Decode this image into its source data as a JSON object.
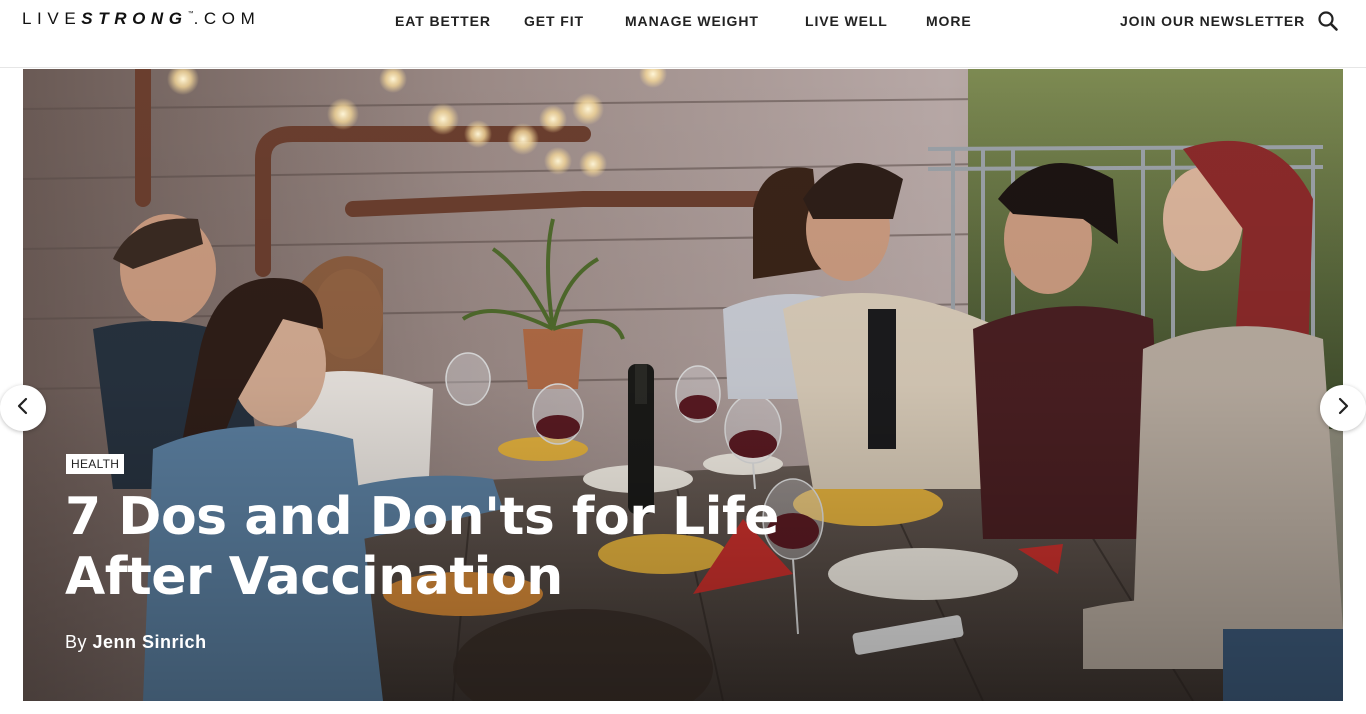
{
  "header": {
    "logo": {
      "pre": "LIVE",
      "bold": "STRONG",
      "tm": "™",
      "post": ".COM"
    },
    "nav": [
      {
        "label": "EAT BETTER"
      },
      {
        "label": "GET FIT"
      },
      {
        "label": "MANAGE WEIGHT"
      },
      {
        "label": "LIVE WELL"
      },
      {
        "label": "MORE"
      }
    ],
    "newsletter": "JOIN OUR NEWSLETTER",
    "search_icon": "search-icon"
  },
  "hero": {
    "category": "HEALTH",
    "title": "7 Dos and Don'ts for Life After Vaccination",
    "byline_prefix": "By",
    "author": "Jenn Sinrich",
    "prev_icon": "chevron-left-icon",
    "next_icon": "chevron-right-icon"
  }
}
